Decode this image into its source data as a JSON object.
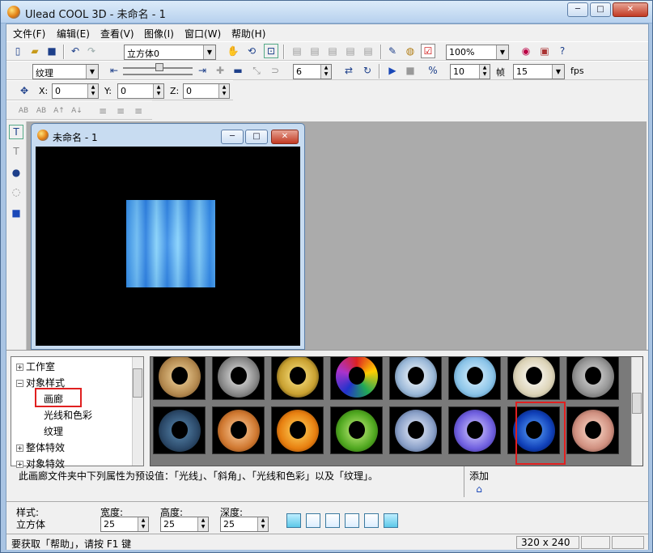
{
  "window": {
    "title": "Ulead COOL 3D - 未命名 - 1",
    "min": "─",
    "max": "□",
    "close": "✕"
  },
  "menu": [
    "文件(F)",
    "编辑(E)",
    "查看(V)",
    "图像(I)",
    "窗口(W)",
    "帮助(H)"
  ],
  "toolbar1": {
    "object_combo": "立方体0",
    "zoom_combo": "100%"
  },
  "toolbar2": {
    "attribute_combo": "纹理",
    "frame_value": "6",
    "speed_value": "10",
    "frame_label": "帧",
    "fps_combo": "15",
    "fps_label": "fps"
  },
  "toolbar3": {
    "x_label": "X:",
    "x_value": "0",
    "y_label": "Y:",
    "y_value": "0",
    "z_label": "Z:",
    "z_value": "0"
  },
  "document": {
    "title": "未命名 - 1"
  },
  "tree": {
    "items": [
      {
        "label": "工作室",
        "expander": "+"
      },
      {
        "label": "对象样式",
        "expander": "−"
      },
      {
        "label": "画廊",
        "expander": ""
      },
      {
        "label": "光线和色彩",
        "expander": ""
      },
      {
        "label": "纹理",
        "expander": ""
      },
      {
        "label": "整体特效",
        "expander": "+"
      },
      {
        "label": "对象特效",
        "expander": "+"
      }
    ]
  },
  "gallery": {
    "row1": [
      "tan-ring",
      "grey-dotted-ring",
      "gold-cutout-ring",
      "mosaic-ring",
      "white-blue-ring",
      "light-blue-ring",
      "cream-ring",
      "studded-metal-ring"
    ],
    "row2": [
      "dark-blue-textured-ring",
      "copper-ring",
      "orange-ring",
      "green-ring",
      "blue-grey-ring",
      "violet-ring",
      "deep-blue-ring",
      "pink-copper-ring"
    ],
    "selected_index": 6
  },
  "description": "此画廊文件夹中下列属性为预设值：「光线」、「斜角」、「光线和色彩」以及「纹理」。",
  "add_label": "添加",
  "props": {
    "style_label": "样式:",
    "style_value": "立方体",
    "width_label": "宽度:",
    "width_value": "25",
    "height_label": "高度:",
    "height_value": "25",
    "depth_label": "深度:",
    "depth_value": "25"
  },
  "status": {
    "help_text": "要获取「帮助」，请按 F1 键",
    "size_text": "320 x 240"
  },
  "colors": {
    "titlebar": "#c7dcf3",
    "workspace": "#ababab",
    "canvas": "#000000",
    "selection": "#e02020"
  }
}
